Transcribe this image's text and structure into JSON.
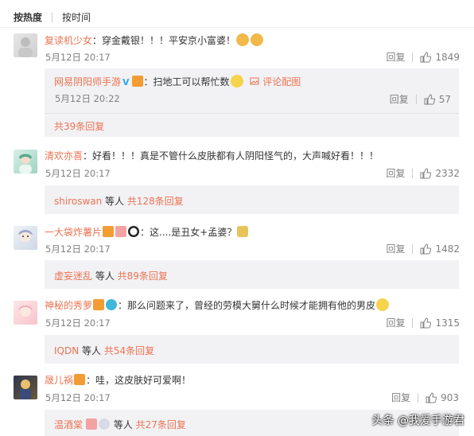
{
  "sort": {
    "hot": "按热度",
    "time": "按时间"
  },
  "colors": {
    "username": "#eb7350",
    "subbox": "#f2f2f5",
    "muted": "#808080"
  },
  "comments": [
    {
      "user": "复读机少女",
      "text": "：穿金戴银！！！平安京小富婆！",
      "time": "5月12日 20:17",
      "reply": "回复",
      "likes": "1849",
      "sub": {
        "user": "网易阴阳师手游",
        "text": "：扫地工可以帮忙数",
        "link": "评论配图",
        "time": "5月12日 20:22",
        "reply": "回复",
        "likes": "57"
      },
      "more": "共39条回复"
    },
    {
      "user": "清欢亦喜",
      "text": "：好看！！！真是不管什么皮肤都有人阴阳怪气的，大声喊好看！！！",
      "time": "5月12日 20:17",
      "reply": "回复",
      "likes": "2332",
      "more_user": "shiroswan",
      "more_mid": " 等人 ",
      "more": "共128条回复"
    },
    {
      "user": "一大袋炸薯片",
      "text": "：这....是丑女+孟婆？",
      "time": "5月12日 20:17",
      "reply": "回复",
      "likes": "1482",
      "more_user": "虚妄迷乱",
      "more_mid": " 等人 ",
      "more": "共89条回复"
    },
    {
      "user": "神秘的秀萝",
      "text": "：那么问题来了，曾经的劳模大舅什么时候才能拥有他的男皮",
      "time": "5月12日 20:17",
      "reply": "回复",
      "likes": "1315",
      "more_user": "IQDN",
      "more_mid": " 等人 ",
      "more": "共54条回复"
    },
    {
      "user": "晟儿祸",
      "text": "：哇，这皮肤好可爱啊！",
      "time": "5月12日 20:17",
      "reply": "回复",
      "likes": "903",
      "more_user": "温酒棠",
      "more_mid": " 等人 ",
      "more": "共27条回复"
    }
  ],
  "watermark": "头条 @我爱手游君"
}
